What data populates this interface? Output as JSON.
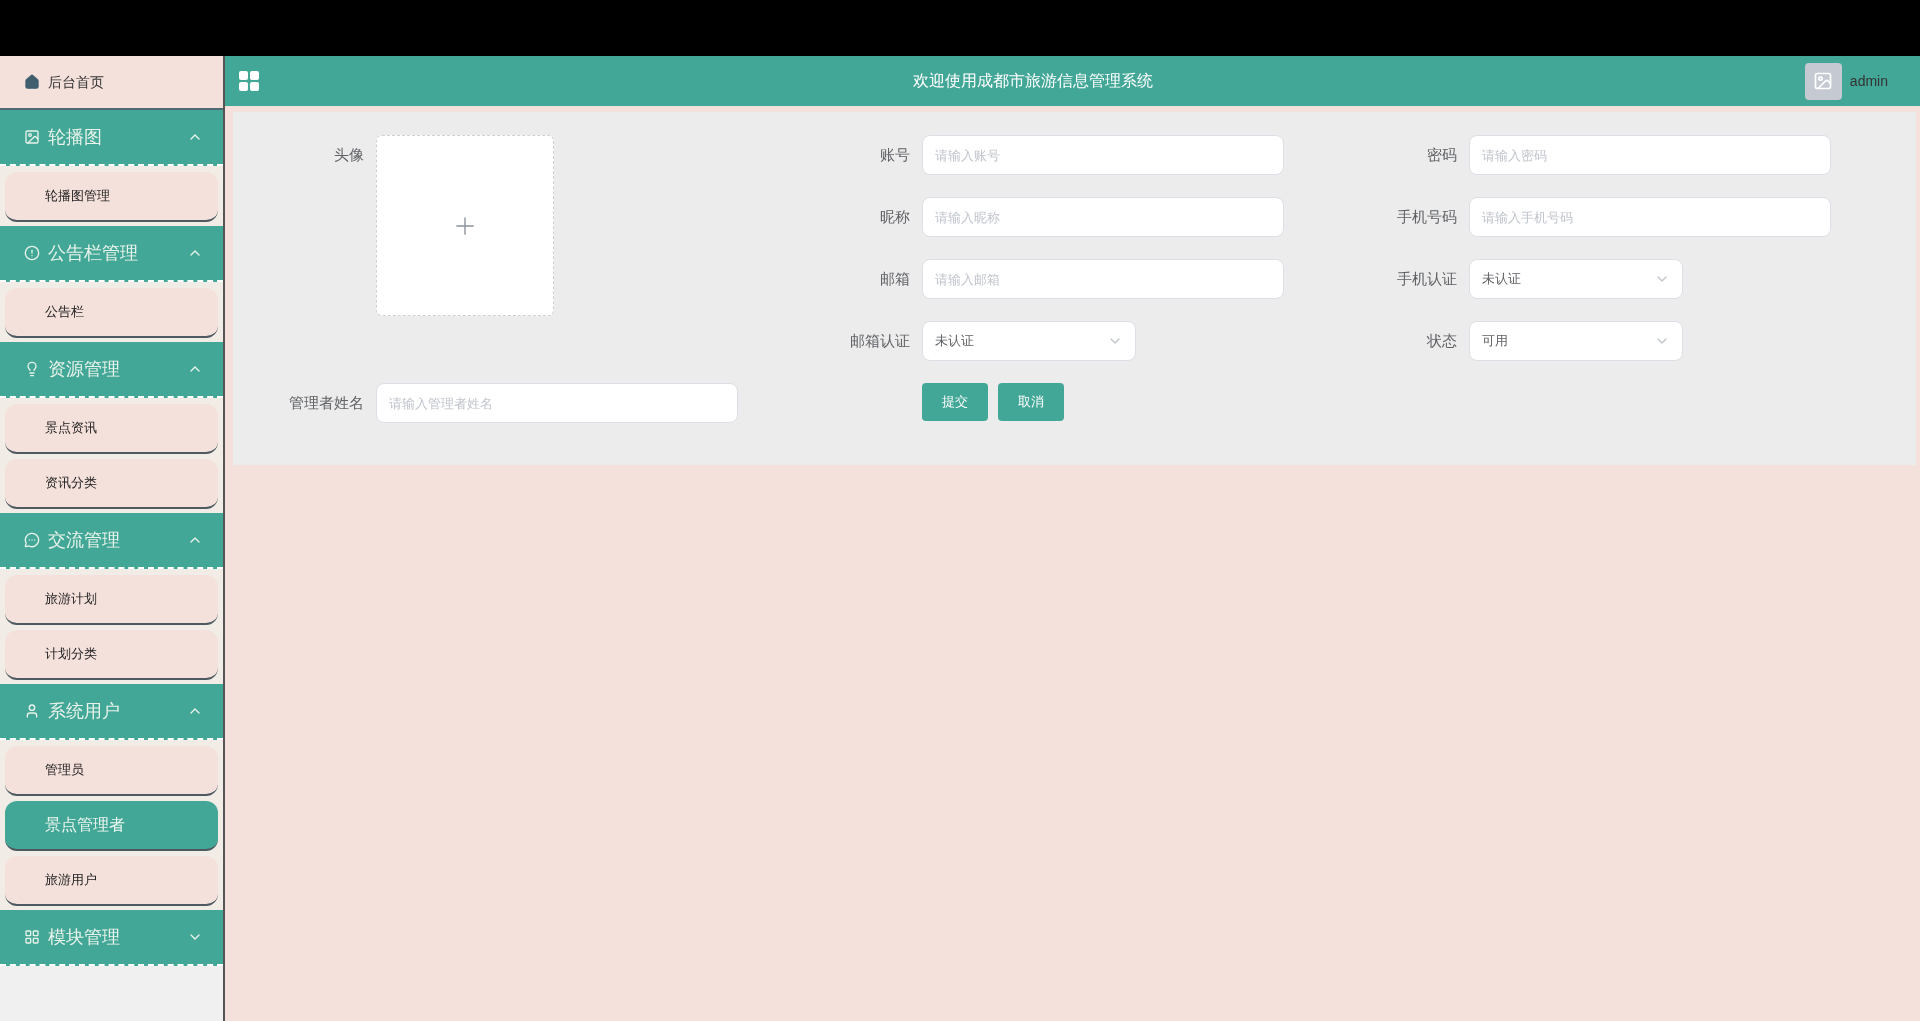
{
  "sidebar": {
    "home": {
      "label": "后台首页"
    },
    "groups": [
      {
        "title": "轮播图",
        "expanded": true,
        "items": [
          {
            "label": "轮播图管理",
            "selected": false
          }
        ]
      },
      {
        "title": "公告栏管理",
        "expanded": true,
        "items": [
          {
            "label": "公告栏",
            "selected": false
          }
        ]
      },
      {
        "title": "资源管理",
        "expanded": true,
        "items": [
          {
            "label": "景点资讯",
            "selected": false
          },
          {
            "label": "资讯分类",
            "selected": false
          }
        ]
      },
      {
        "title": "交流管理",
        "expanded": true,
        "items": [
          {
            "label": "旅游计划",
            "selected": false
          },
          {
            "label": "计划分类",
            "selected": false
          }
        ]
      },
      {
        "title": "系统用户",
        "expanded": true,
        "items": [
          {
            "label": "管理员",
            "selected": false
          },
          {
            "label": "景点管理者",
            "selected": true
          },
          {
            "label": "旅游用户",
            "selected": false
          }
        ]
      },
      {
        "title": "模块管理",
        "expanded": false
      }
    ]
  },
  "header": {
    "title": "欢迎使用成都市旅游信息管理系统",
    "user": "admin"
  },
  "form": {
    "fields": [
      {
        "kind": "upload",
        "label": "头像"
      },
      {
        "kind": "input",
        "label": "账号",
        "placeholder": "请输入账号"
      },
      {
        "kind": "input",
        "label": "密码",
        "placeholder": "请输入密码"
      },
      {
        "kind": "input",
        "label": "昵称",
        "placeholder": "请输入昵称"
      },
      {
        "kind": "input",
        "label": "手机号码",
        "placeholder": "请输入手机号码"
      },
      {
        "kind": "input",
        "label": "邮箱",
        "placeholder": "请输入邮箱"
      },
      {
        "kind": "select",
        "label": "手机认证",
        "value": "未认证"
      },
      {
        "kind": "select",
        "label": "邮箱认证",
        "value": "未认证"
      },
      {
        "kind": "select",
        "label": "状态",
        "value": "可用"
      },
      {
        "kind": "input",
        "label": "管理者姓名",
        "placeholder": "请输入管理者姓名"
      }
    ],
    "buttons": [
      "提交",
      "取消"
    ]
  }
}
